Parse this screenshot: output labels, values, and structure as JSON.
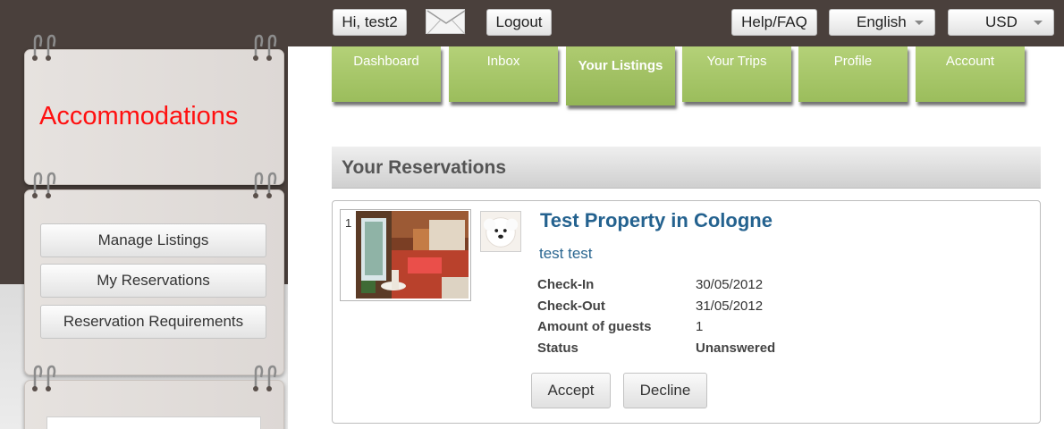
{
  "topbar": {
    "greeting": "Hi, test2",
    "logout_label": "Logout",
    "help_label": "Help/FAQ",
    "language_selected": "English",
    "currency_selected": "USD"
  },
  "sidebar": {
    "title": "Accommodations",
    "items": [
      {
        "label": "Manage Listings"
      },
      {
        "label": "My Reservations"
      },
      {
        "label": "Reservation Requirements"
      }
    ]
  },
  "tabs": [
    {
      "label": "Dashboard"
    },
    {
      "label": "Inbox"
    },
    {
      "label": "Your Listings"
    },
    {
      "label": "Your Trips"
    },
    {
      "label": "Profile"
    },
    {
      "label": "Account"
    }
  ],
  "reservations": {
    "header": "Your Reservations",
    "item": {
      "photo_index": "1",
      "property_title": "Test Property in Cologne",
      "guest_name": "test test",
      "details": [
        {
          "label": "Check-In",
          "value": "30/05/2012"
        },
        {
          "label": "Check-Out",
          "value": "31/05/2012"
        },
        {
          "label": "Amount of guests",
          "value": "1"
        },
        {
          "label": "Status",
          "value": "Unanswered"
        }
      ],
      "accept_label": "Accept",
      "decline_label": "Decline"
    }
  },
  "colors": {
    "accent_title": "#ff1010",
    "tab_green": "#a5c466",
    "link_blue": "#24628f",
    "top_bar": "#4a403c"
  },
  "icons": [
    "envelope-icon",
    "chevron-down-icon",
    "binder-ring-icon",
    "property-photo",
    "dog-avatar"
  ]
}
